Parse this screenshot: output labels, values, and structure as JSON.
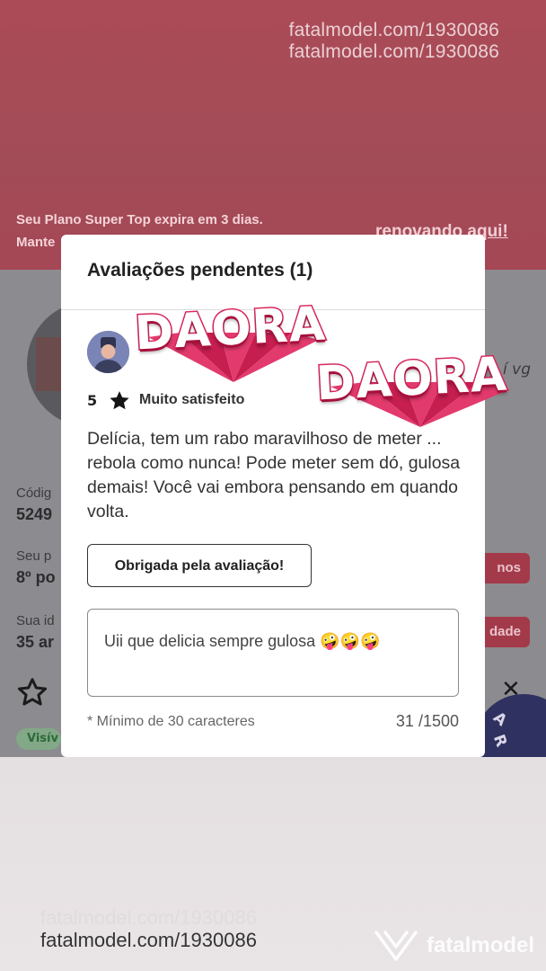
{
  "watermarks": {
    "top_1": "fatalmodel.com/1930086",
    "top_2": "fatalmodel.com/1930086",
    "bottom_1": "fatalmodel.com/1930086",
    "bottom_2": "fatalmodel.com/1930086",
    "brand": "fatalmodel"
  },
  "plan_banner": {
    "line_1": "Seu Plano Super Top expira em 3 dias.",
    "line_2": "Mante",
    "link": "renovando aqui!"
  },
  "background_page": {
    "code_label": "Códig",
    "code_value": "5249",
    "position_label": "Seu p",
    "position_value": "8º po",
    "position_button": "nos",
    "age_label": "Sua id",
    "age_value": "35 ar",
    "age_button": "dade",
    "location_fragment": "í vg",
    "visible_badge": "Visív",
    "circle_letters": [
      "A",
      "R"
    ],
    "colors": {
      "dim": "#8c8b8f",
      "pill": "#a33a4a",
      "circle": "#2f3160"
    }
  },
  "modal": {
    "title": "Avaliações pendentes (1)",
    "review": {
      "rating_value": "5",
      "rating_icon": "star-icon",
      "rating_label": "Muito satisfeito",
      "text": "Delícia, tem um rabo maravilhoso de meter ... rebola como nunca! Pode meter sem dó, gulosa demais! Você vai embora pensando em quando volta."
    },
    "thanks_button": "Obrigada pela avaliação!",
    "reply": {
      "value": "Uii que delicia sempre gulosa 🤪🤪🤪"
    },
    "min_chars_hint": "* Mínimo de 30 caracteres",
    "char_count": "31 /1500"
  },
  "stickers": [
    {
      "text": "DAORA"
    },
    {
      "text": "DAORA"
    }
  ],
  "colors": {
    "top_band": "#a24c57",
    "sticker_pink": "#d7265b",
    "modal_bg": "#ffffff"
  }
}
